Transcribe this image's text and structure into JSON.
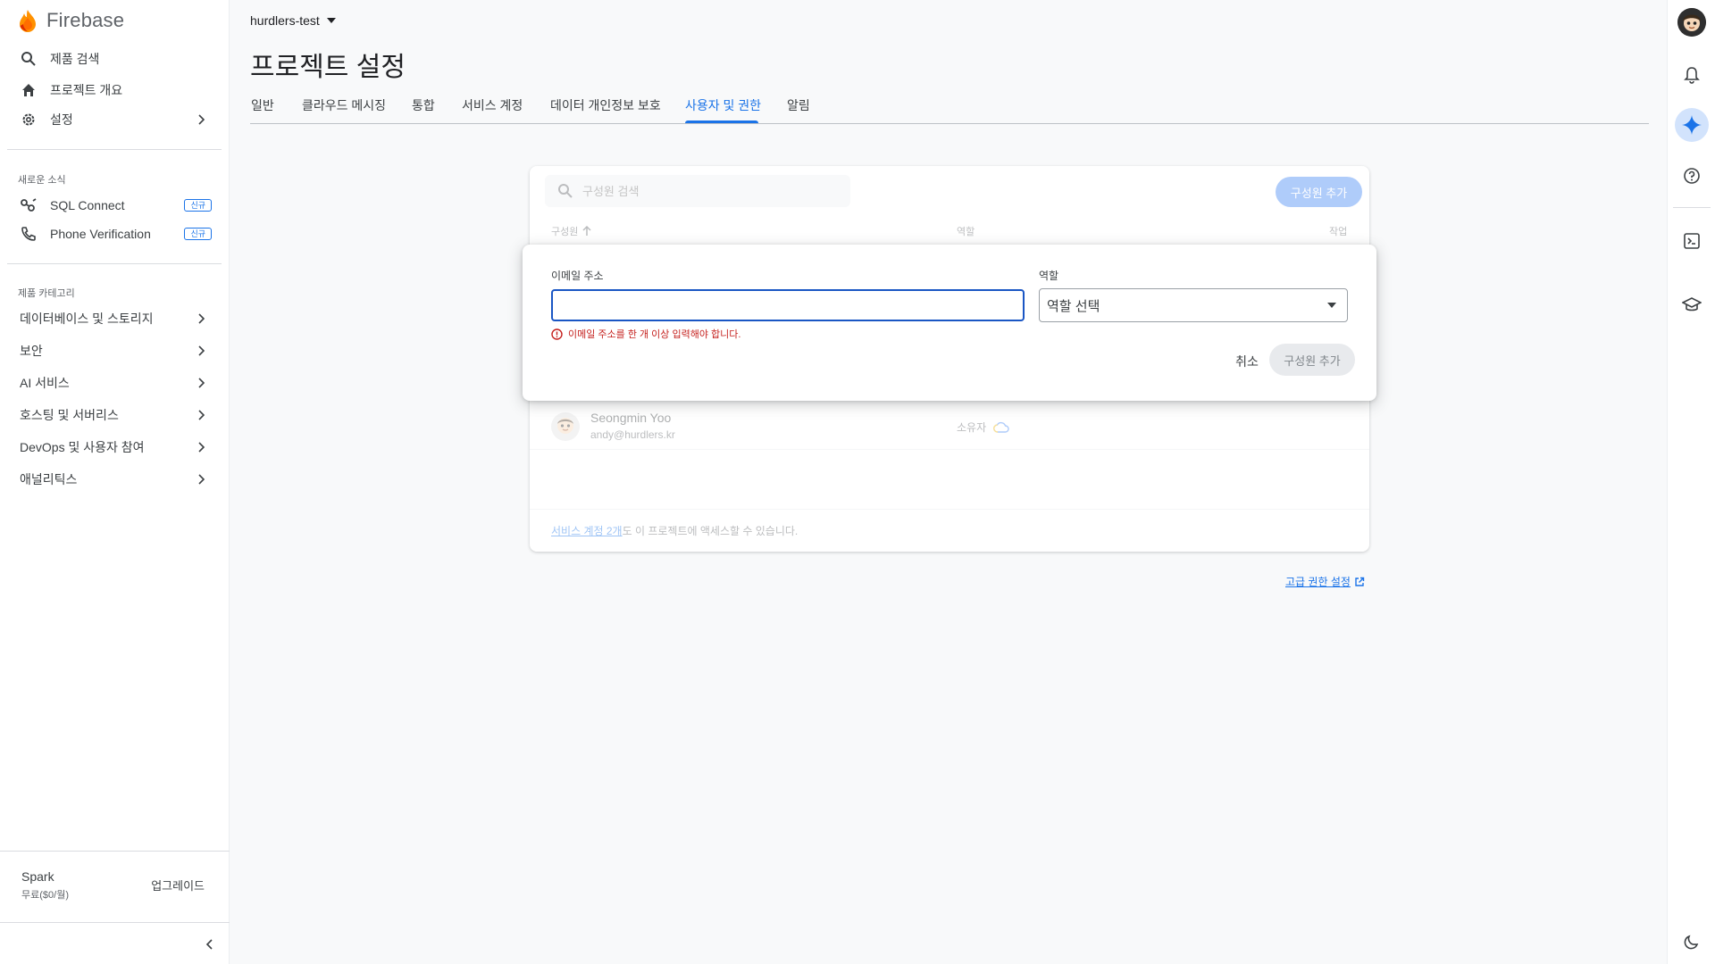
{
  "sidebar": {
    "brand": "Firebase",
    "top_items": [
      {
        "label": "제품 검색",
        "icon": "search-icon"
      },
      {
        "label": "프로젝트 개요",
        "icon": "home-icon"
      },
      {
        "label": "설정",
        "icon": "gear-icon"
      }
    ],
    "news_label": "새로운 소식",
    "news_items": [
      {
        "label": "SQL Connect",
        "badge": "신규",
        "icon": "sql-connect-icon"
      },
      {
        "label": "Phone Verification",
        "badge": "신규",
        "icon": "phone-icon"
      }
    ],
    "category_label": "제품 카테고리",
    "categories": [
      {
        "label": "데이터베이스 및 스토리지"
      },
      {
        "label": "보안"
      },
      {
        "label": "AI 서비스"
      },
      {
        "label": "호스팅 및 서버리스"
      },
      {
        "label": "DevOps 및 사용자 참여"
      },
      {
        "label": "애널리틱스"
      }
    ],
    "plan": {
      "name": "Spark",
      "price": "무료($0/월)",
      "upgrade": "업그레이드"
    }
  },
  "header": {
    "project": "hurdlers-test",
    "title": "프로젝트 설정",
    "tabs": [
      {
        "label": "일반"
      },
      {
        "label": "클라우드 메시징"
      },
      {
        "label": "통합"
      },
      {
        "label": "서비스 계정"
      },
      {
        "label": "데이터 개인정보 보호"
      },
      {
        "label": "사용자 및 권한",
        "active": true
      },
      {
        "label": "알림"
      }
    ]
  },
  "members": {
    "search_placeholder": "구성원 검색",
    "add_button": "구성원 추가",
    "columns": {
      "member": "구성원",
      "role": "역할",
      "action": "작업"
    },
    "rows": [
      {
        "name": "Seongmin Yoo",
        "email": "andy@hurdlers.kr",
        "role": "소유자"
      }
    ],
    "footer_link": "서비스 계정 2개",
    "footer_text": " 도 이 프로젝트에 액세스할 수 있습니다."
  },
  "dialog": {
    "email_label": "이메일 주소",
    "email_value": "",
    "error": "이메일 주소를 한 개 이상 입력해야 합니다.",
    "role_label": "역할",
    "role_value": "역할 선택",
    "cancel": "취소",
    "submit": "구성원 추가"
  },
  "advanced_link": "고급 권한 설정",
  "colors": {
    "accent": "#1a73e8",
    "error": "#c5221f",
    "brand_orange": "#ff9100"
  }
}
